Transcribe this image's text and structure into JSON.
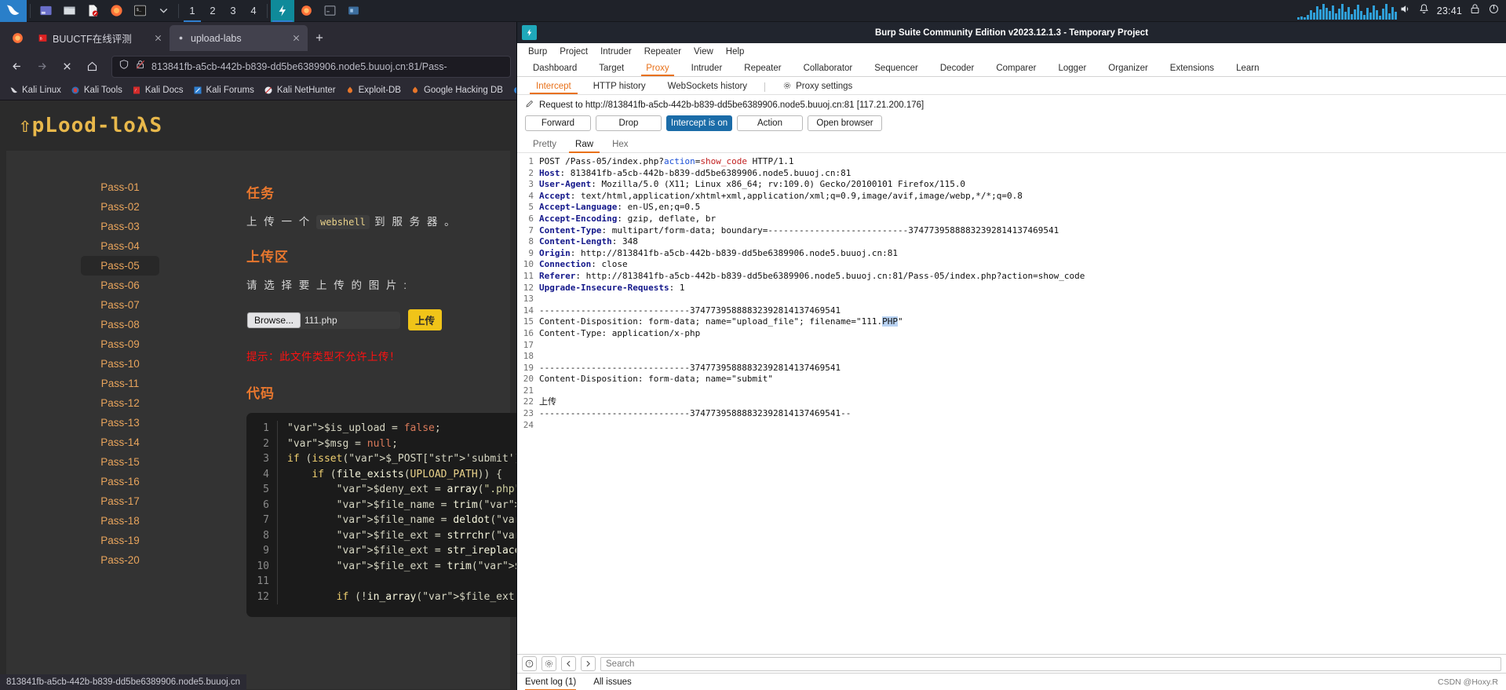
{
  "taskbar": {
    "workspaces": [
      "1",
      "2",
      "3",
      "4"
    ],
    "active_workspace": "1",
    "clock": "23:41",
    "icons": [
      {
        "name": "kali-menu-icon"
      },
      {
        "name": "files-icon"
      },
      {
        "name": "folder-icon"
      },
      {
        "name": "document-icon"
      },
      {
        "name": "firefox-icon"
      },
      {
        "name": "terminal-icon"
      },
      {
        "name": "chevron-down-icon"
      }
    ],
    "window_icons": [
      {
        "name": "burp-icon"
      },
      {
        "name": "firefox-icon"
      },
      {
        "name": "terminal-window-icon"
      },
      {
        "name": "file-manager-icon"
      }
    ],
    "tray": [
      {
        "name": "volume-icon"
      },
      {
        "name": "bell-icon"
      },
      {
        "name": "lock-icon"
      },
      {
        "name": "power-icon"
      }
    ]
  },
  "firefox": {
    "tabs": [
      {
        "label": "BUUCTF在线评测",
        "active": false
      },
      {
        "label": "upload-labs",
        "active": true
      }
    ],
    "new_tab_label": "+",
    "nav": {
      "back": "back-icon",
      "forward": "forward-icon",
      "stop": "stop-icon",
      "home": "home-icon"
    },
    "url": "813841fb-a5cb-442b-b839-dd5be6389906.node5.buuoj.cn:81/Pass-",
    "bookmarks": [
      "Kali Linux",
      "Kali Tools",
      "Kali Docs",
      "Kali Forums",
      "Kali NetHunter",
      "Exploit-DB",
      "Google Hacking DB"
    ],
    "status_url": "813841fb-a5cb-442b-b839-dd5be6389906.node5.buuoj.cn"
  },
  "uploadlabs": {
    "logo": "⇧pLood-loλS",
    "passes": [
      "Pass-01",
      "Pass-02",
      "Pass-03",
      "Pass-04",
      "Pass-05",
      "Pass-06",
      "Pass-07",
      "Pass-08",
      "Pass-09",
      "Pass-10",
      "Pass-11",
      "Pass-12",
      "Pass-13",
      "Pass-14",
      "Pass-15",
      "Pass-16",
      "Pass-17",
      "Pass-18",
      "Pass-19",
      "Pass-20"
    ],
    "selected_pass": "Pass-05",
    "task_heading": "任务",
    "task_text_before": "上 传 一 个 ",
    "task_code": "webshell",
    "task_text_after": " 到 服 务 器 。",
    "upload_heading": "上传区",
    "upload_prompt": "请 选 择 要 上 传 的 图 片 :",
    "browse_label": "Browse...",
    "file_name": "111.php",
    "submit_label": "上传",
    "error_text": "提示：此文件类型不允许上传！",
    "code_heading": "代码",
    "code_lines": [
      {
        "n": "1",
        "text": "$is_upload = false;"
      },
      {
        "n": "2",
        "text": "$msg = null;"
      },
      {
        "n": "3",
        "text": "if (isset($_POST['submit'])) {"
      },
      {
        "n": "4",
        "text": "    if (file_exists(UPLOAD_PATH)) {"
      },
      {
        "n": "5",
        "text": "        $deny_ext = array(\".php\",\".php"
      },
      {
        "n": "6",
        "text": "        $file_name = trim($_FILES['up"
      },
      {
        "n": "7",
        "text": "        $file_name = deldot($file_nam"
      },
      {
        "n": "8",
        "text": "        $file_ext = strrchr($file_nam"
      },
      {
        "n": "9",
        "text": "        $file_ext = str_ireplace('::$"
      },
      {
        "n": "10",
        "text": "        $file_ext = trim($file_ext);"
      },
      {
        "n": "11",
        "text": ""
      },
      {
        "n": "12",
        "text": "        if (!in_array($file_ext, $deny"
      }
    ]
  },
  "burp": {
    "title": "Burp Suite Community Edition v2023.12.1.3 - Temporary Project",
    "menu": [
      "Burp",
      "Project",
      "Intruder",
      "Repeater",
      "View",
      "Help"
    ],
    "tabs": [
      "Dashboard",
      "Target",
      "Proxy",
      "Intruder",
      "Repeater",
      "Collaborator",
      "Sequencer",
      "Decoder",
      "Comparer",
      "Logger",
      "Organizer",
      "Extensions",
      "Learn"
    ],
    "active_tab": "Proxy",
    "subtabs": [
      "Intercept",
      "HTTP history",
      "WebSockets history"
    ],
    "active_subtab": "Intercept",
    "proxy_settings_label": "Proxy settings",
    "request_line": "Request to http://813841fb-a5cb-442b-b839-dd5be6389906.node5.buuoj.cn:81  [117.21.200.176]",
    "actions": [
      "Forward",
      "Drop",
      "Intercept is on",
      "Action",
      "Open browser"
    ],
    "intercept_toggle": "Intercept is on",
    "formats": [
      "Pretty",
      "Raw",
      "Hex"
    ],
    "active_format": "Raw",
    "raw_lines": [
      {
        "n": "1",
        "segments": [
          {
            "t": "POST ",
            "c": "plain"
          },
          {
            "t": "/Pass-05/index.php?",
            "c": "plain"
          },
          {
            "t": "action",
            "c": "blu"
          },
          {
            "t": "=",
            "c": "plain"
          },
          {
            "t": "show_code",
            "c": "red"
          },
          {
            "t": " HTTP/1.1",
            "c": "plain"
          }
        ]
      },
      {
        "n": "2",
        "segments": [
          {
            "t": "Host",
            "c": "hdr"
          },
          {
            "t": ": 813841fb-a5cb-442b-b839-dd5be6389906.node5.buuoj.cn:81",
            "c": "plain"
          }
        ]
      },
      {
        "n": "3",
        "segments": [
          {
            "t": "User-Agent",
            "c": "hdr"
          },
          {
            "t": ": Mozilla/5.0 (X11; Linux x86_64; rv:109.0) Gecko/20100101 Firefox/115.0",
            "c": "plain"
          }
        ]
      },
      {
        "n": "4",
        "segments": [
          {
            "t": "Accept",
            "c": "hdr"
          },
          {
            "t": ": text/html,application/xhtml+xml,application/xml;q=0.9,image/avif,image/webp,*/*;q=0.8",
            "c": "plain"
          }
        ]
      },
      {
        "n": "5",
        "segments": [
          {
            "t": "Accept-Language",
            "c": "hdr"
          },
          {
            "t": ": en-US,en;q=0.5",
            "c": "plain"
          }
        ]
      },
      {
        "n": "6",
        "segments": [
          {
            "t": "Accept-Encoding",
            "c": "hdr"
          },
          {
            "t": ": gzip, deflate, br",
            "c": "plain"
          }
        ]
      },
      {
        "n": "7",
        "segments": [
          {
            "t": "Content-Type",
            "c": "hdr"
          },
          {
            "t": ": multipart/form-data; boundary=---------------------------37477395888832392814137469541",
            "c": "plain"
          }
        ]
      },
      {
        "n": "8",
        "segments": [
          {
            "t": "Content-Length",
            "c": "hdr"
          },
          {
            "t": ": 348",
            "c": "plain"
          }
        ]
      },
      {
        "n": "9",
        "segments": [
          {
            "t": "Origin",
            "c": "hdr"
          },
          {
            "t": ": http://813841fb-a5cb-442b-b839-dd5be6389906.node5.buuoj.cn:81",
            "c": "plain"
          }
        ]
      },
      {
        "n": "10",
        "segments": [
          {
            "t": "Connection",
            "c": "hdr"
          },
          {
            "t": ": close",
            "c": "plain"
          }
        ]
      },
      {
        "n": "11",
        "segments": [
          {
            "t": "Referer",
            "c": "hdr"
          },
          {
            "t": ": http://813841fb-a5cb-442b-b839-dd5be6389906.node5.buuoj.cn:81/Pass-05/index.php?action=show_code",
            "c": "plain"
          }
        ]
      },
      {
        "n": "12",
        "segments": [
          {
            "t": "Upgrade-Insecure-Requests",
            "c": "hdr"
          },
          {
            "t": ": 1",
            "c": "plain"
          }
        ]
      },
      {
        "n": "13",
        "segments": [
          {
            "t": "",
            "c": "plain"
          }
        ]
      },
      {
        "n": "14",
        "segments": [
          {
            "t": "-----------------------------37477395888832392814137469541",
            "c": "plain"
          }
        ]
      },
      {
        "n": "15",
        "segments": [
          {
            "t": "Content-Disposition: form-data; name=\"upload_file\"; filename=\"111.",
            "c": "plain"
          },
          {
            "t": "PHP",
            "c": "sel"
          },
          {
            "t": "\"",
            "c": "plain"
          }
        ]
      },
      {
        "n": "16",
        "segments": [
          {
            "t": "Content-Type: application/x-php",
            "c": "plain"
          }
        ]
      },
      {
        "n": "17",
        "segments": [
          {
            "t": "",
            "c": "plain"
          }
        ]
      },
      {
        "n": "18",
        "segments": [
          {
            "t": "",
            "c": "plain"
          }
        ]
      },
      {
        "n": "19",
        "segments": [
          {
            "t": "-----------------------------37477395888832392814137469541",
            "c": "plain"
          }
        ]
      },
      {
        "n": "20",
        "segments": [
          {
            "t": "Content-Disposition: form-data; name=\"submit\"",
            "c": "plain"
          }
        ]
      },
      {
        "n": "21",
        "segments": [
          {
            "t": "",
            "c": "plain"
          }
        ]
      },
      {
        "n": "22",
        "segments": [
          {
            "t": "上传",
            "c": "plain"
          }
        ]
      },
      {
        "n": "23",
        "segments": [
          {
            "t": "-----------------------------37477395888832392814137469541--",
            "c": "plain"
          }
        ]
      },
      {
        "n": "24",
        "segments": [
          {
            "t": "",
            "c": "plain"
          }
        ]
      }
    ],
    "search_placeholder": "Search",
    "event_log": "Event log (1)",
    "all_issues": "All issues",
    "watermark": "CSDN @Hoxy.R"
  },
  "colors": {
    "burp_accent": "#e8711a",
    "intercept_on": "#1b6ca8",
    "upload_accent": "#e8772e",
    "pass_link": "#e8a45c",
    "error_red": "#ff1111",
    "submit_yellow": "#f0c419"
  }
}
